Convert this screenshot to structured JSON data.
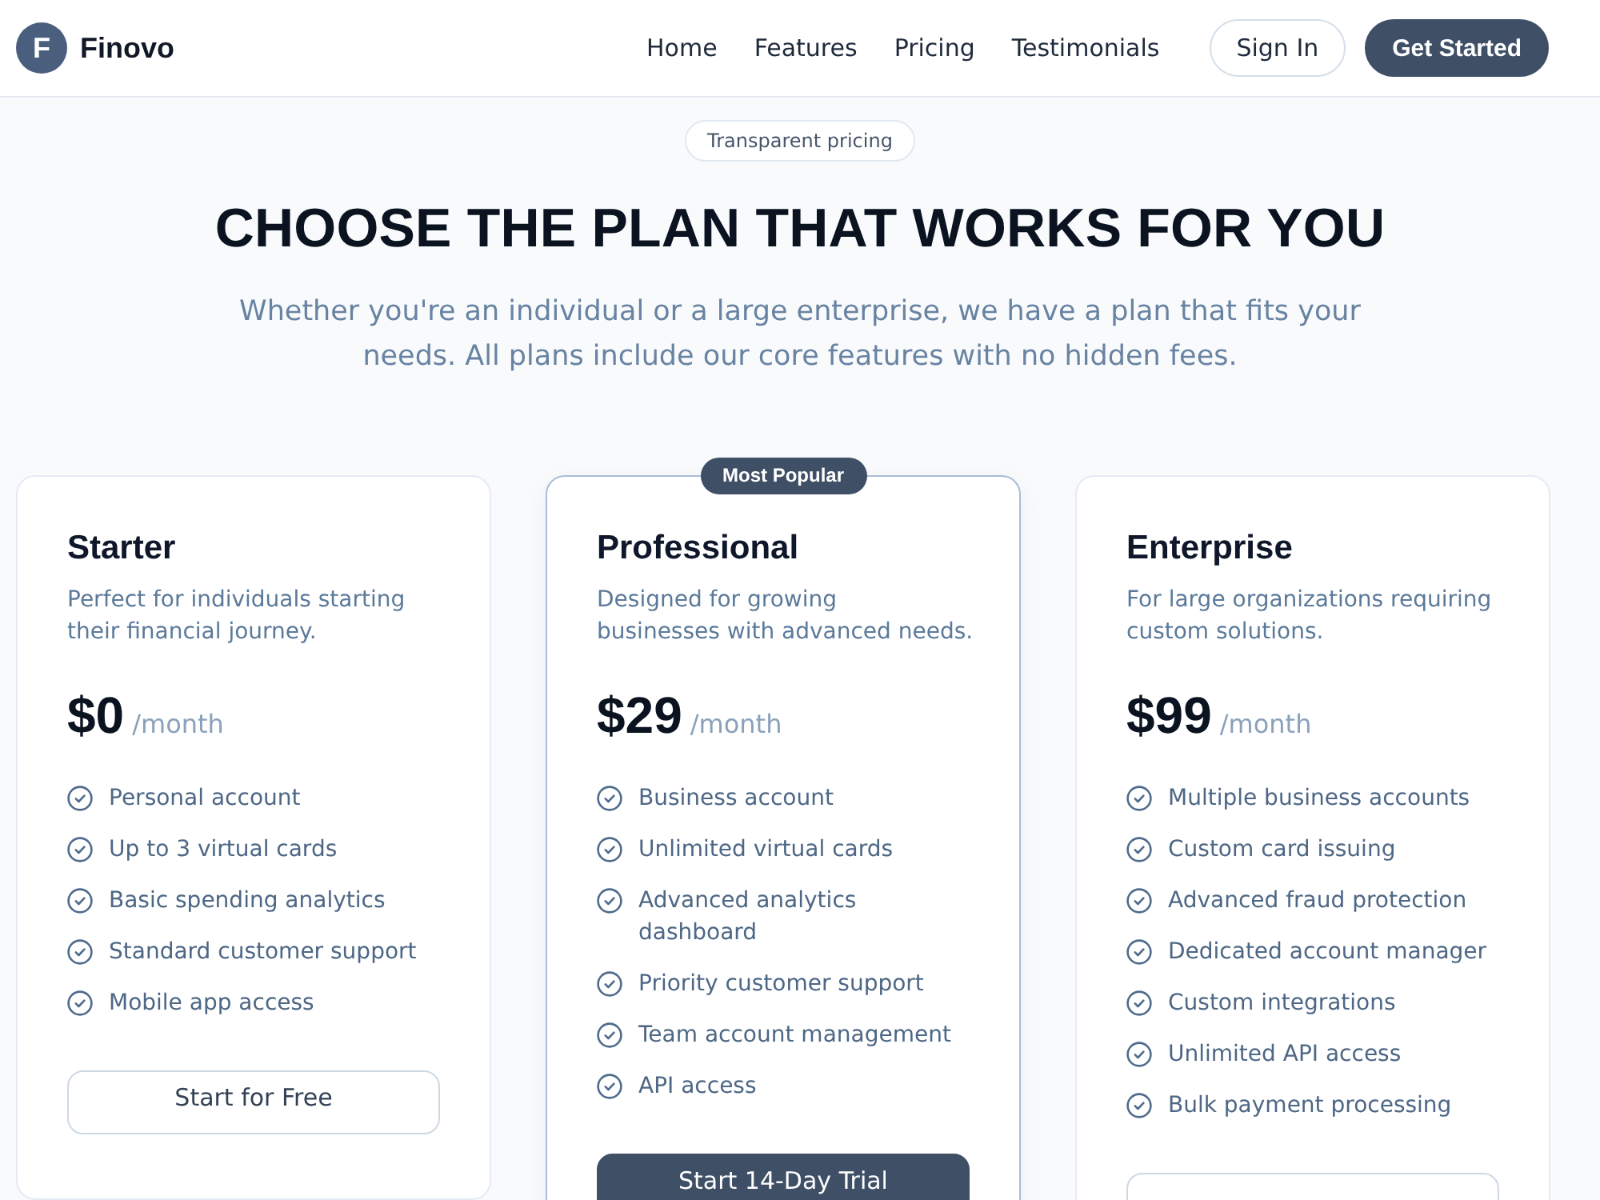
{
  "header": {
    "logo": {
      "letter": "F",
      "name": "Finovo"
    },
    "nav_links": [
      "Home",
      "Features",
      "Pricing",
      "Testimonials"
    ],
    "buttons": [
      {
        "label": "Sign In",
        "kind": "outline"
      },
      {
        "label": "Get Started",
        "kind": "solid"
      }
    ]
  },
  "hero": {
    "badge": "Transparent pricing",
    "title": "CHOOSE THE PLAN THAT WORKS FOR YOU",
    "subtitle": "Whether you're an individual or a large enterprise, we have a plan that fits your needs. All plans include our core features with no hidden fees."
  },
  "plans": [
    {
      "name": "Starter",
      "featured": false,
      "description": "Perfect for individuals starting\ntheir financial journey.",
      "price": "$0",
      "period": "/month",
      "features": [
        "Personal account",
        "Up to 3 virtual cards",
        "Basic spending analytics",
        "Standard customer support",
        "Mobile app access"
      ],
      "button": {
        "label": "Start for Free",
        "kind": "outline"
      }
    },
    {
      "name": "Professional",
      "featured": true,
      "badge": "Most Popular",
      "description": "Designed for growing\nbusinesses with advanced needs.",
      "price": "$29",
      "period": "/month",
      "features": [
        "Business account",
        "Unlimited virtual cards",
        "Advanced analytics dashboard",
        "Priority customer support",
        "Team account management",
        "API access"
      ],
      "button": {
        "label": "Start 14-Day Trial",
        "kind": "solid"
      }
    },
    {
      "name": "Enterprise",
      "featured": false,
      "description": "For large organizations requiring\ncustom solutions.",
      "price": "$99",
      "period": "/month",
      "features": [
        "Multiple business accounts",
        "Custom card issuing",
        "Advanced fraud protection",
        "Dedicated account manager",
        "Custom integrations",
        "Unlimited API access",
        "Bulk payment processing"
      ],
      "button": {
        "kind": "outline"
      }
    }
  ]
}
